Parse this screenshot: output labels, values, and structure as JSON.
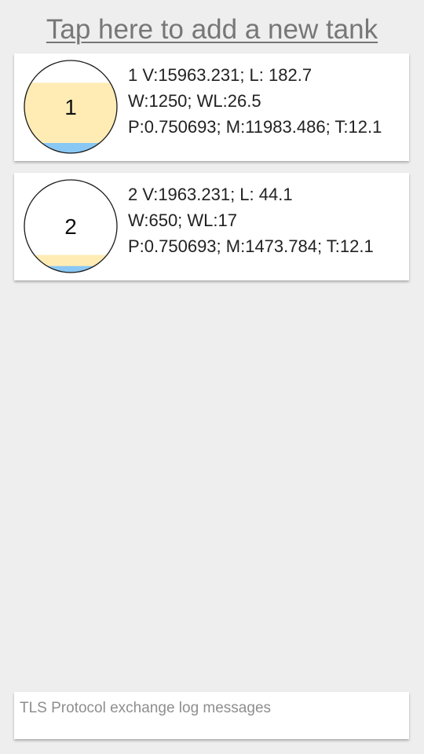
{
  "header": {
    "add_tank_label": "Tap here to add a new tank"
  },
  "tanks": [
    {
      "number": "1",
      "line1": "1  V:15963.231; L: 182.7",
      "line2": "W:1250; WL:26.5",
      "line3": "P:0.750693; M:11983.486; T:12.1",
      "product_level_fraction": 0.76,
      "water_level_fraction": 0.11
    },
    {
      "number": "2",
      "line1": "2  V:1963.231; L: 44.1",
      "line2": "W:650; WL:17",
      "line3": "P:0.750693; M:1473.784; T:12.1",
      "product_level_fraction": 0.19,
      "water_level_fraction": 0.07
    }
  ],
  "log": {
    "placeholder": "TLS Protocol exchange log messages"
  },
  "colors": {
    "background": "#eeeeee",
    "card": "#ffffff",
    "product": "#ffecb5",
    "water": "#89c8f5",
    "outline": "#1a1a1a",
    "link": "#777777"
  }
}
